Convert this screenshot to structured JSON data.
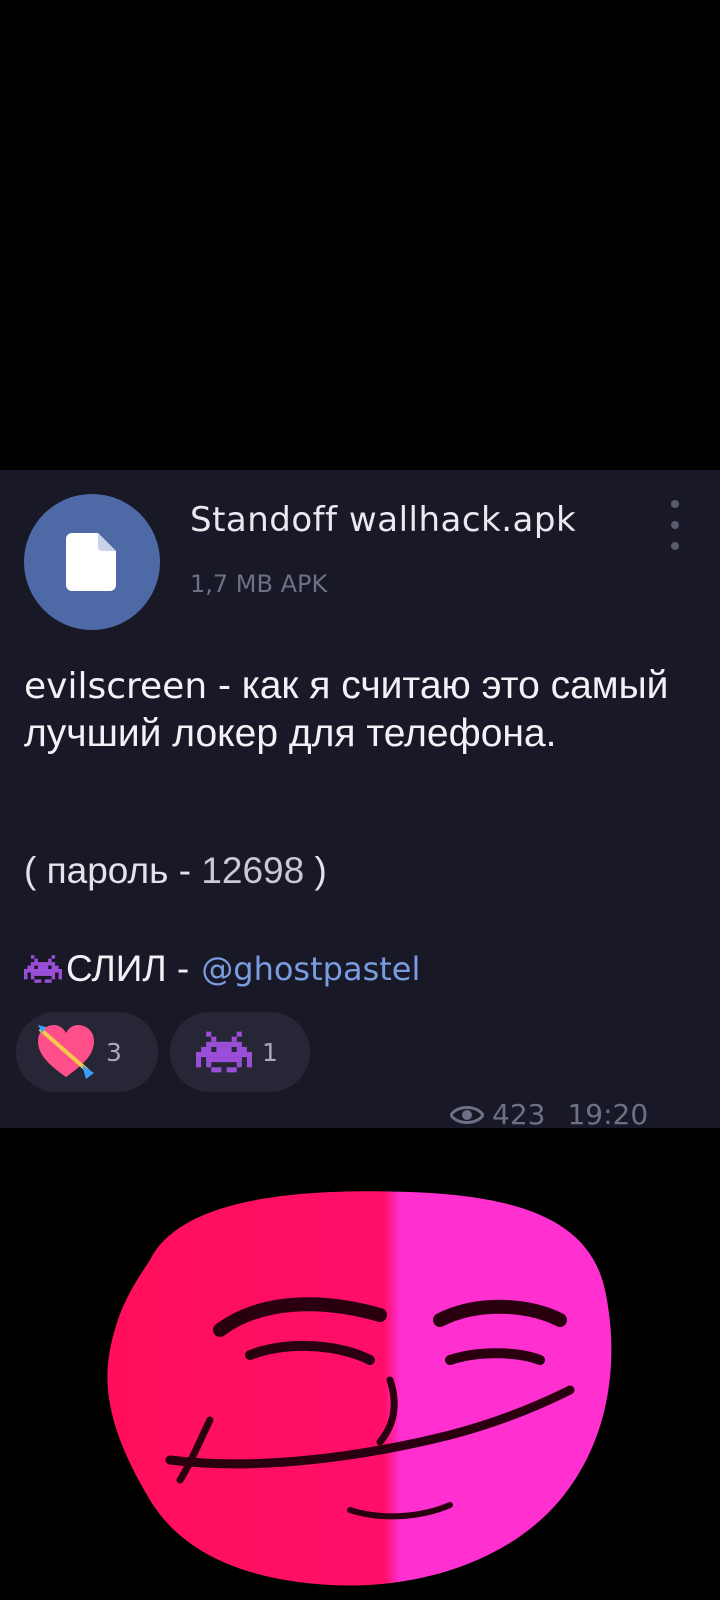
{
  "file": {
    "name": "Standoff  wallhack.apk",
    "meta": "1,7 MB APK",
    "icon": "document-icon"
  },
  "message": {
    "lead": "evilscreen",
    "body": " - как я считаю это самый лучший локер для телефона.",
    "password_prefix": "( пароль - ",
    "password_value": "12698",
    "password_suffix": " )",
    "leak_label": "СЛИЛ -",
    "leak_handle": "@ghostpastel"
  },
  "reactions": [
    {
      "emoji": "heart-with-arrow-icon",
      "count": "3"
    },
    {
      "emoji": "alien-monster-icon",
      "count": "1"
    }
  ],
  "footer": {
    "views": "423",
    "time": "19:20"
  },
  "colors": {
    "background": "#000000",
    "bubble": "#181826",
    "file_icon": "#4e6aa6",
    "link": "#7a9ce0",
    "meme_face": "#ff0f6a"
  }
}
